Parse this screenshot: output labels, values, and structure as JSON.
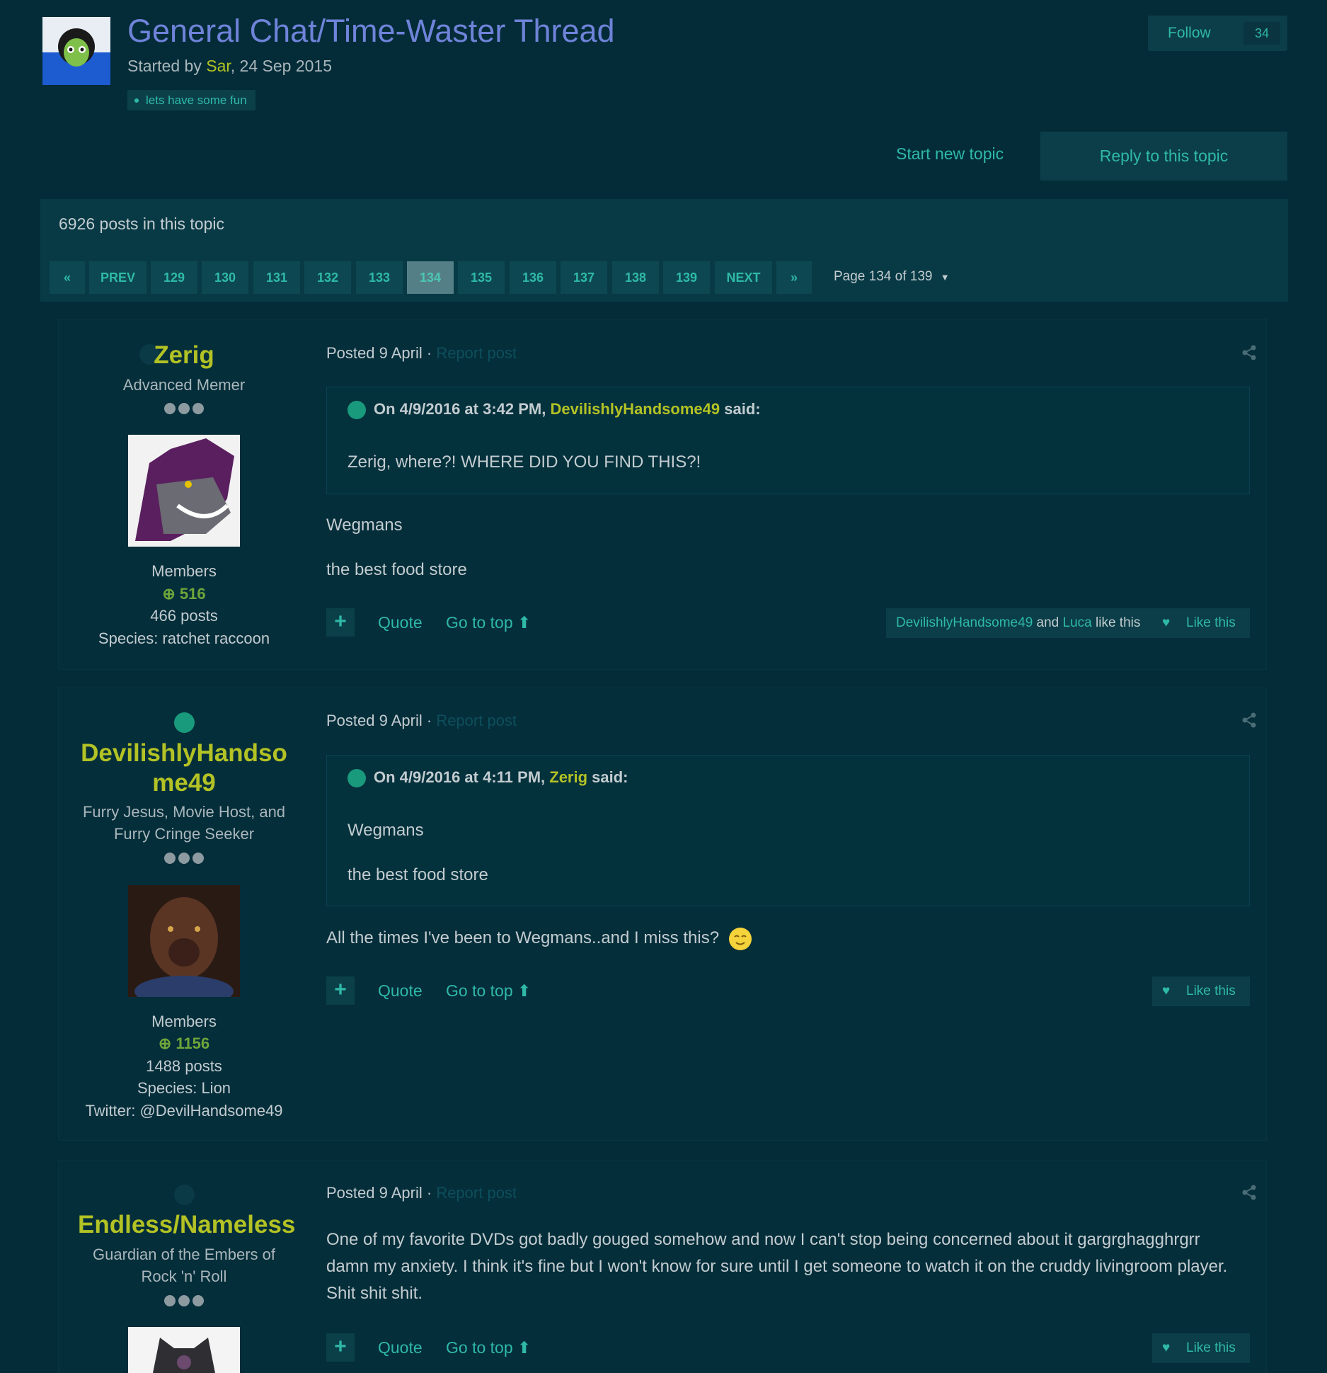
{
  "thread": {
    "title": "General Chat/Time-Waster Thread",
    "started_prefix": "Started by ",
    "author": "Sar",
    "date": ", 24 Sep 2015",
    "tag": "lets have some fun",
    "follow_label": "Follow",
    "follow_count": "34"
  },
  "actions": {
    "start_topic": "Start new topic",
    "reply": "Reply to this topic"
  },
  "pagination": {
    "post_count": "6926 posts in this topic",
    "prev": "PREV",
    "next": "NEXT",
    "pages": [
      "129",
      "130",
      "131",
      "132",
      "133",
      "134",
      "135",
      "136",
      "137",
      "138",
      "139"
    ],
    "current": "134",
    "page_of": "Page 134 of 139"
  },
  "posts": [
    {
      "username": "Zerig",
      "rank": "Advanced Memer",
      "group": "Members",
      "rep": "516",
      "post_count": "466 posts",
      "species": "Species: ratchet raccoon",
      "posted": "Posted 9 April",
      "report": "Report post",
      "quote_prefix": "On 4/9/2016 at 3:42 PM, ",
      "quote_author": "DevilishlyHandsome49",
      "quote_suffix": " said:",
      "quote_lines": [
        "Zerig, where?! WHERE DID YOU FIND THIS?!"
      ],
      "body": [
        "Wegmans",
        "the best food store"
      ],
      "likers_a": "DevilishlyHandsome49",
      "likers_and": " and ",
      "likers_b": "Luca",
      "likers_tail": " like this"
    },
    {
      "username_line1": "DevilishlyHandso",
      "username_line2": "me49",
      "rank_line1": "Furry Jesus, Movie Host, and",
      "rank_line2": "Furry Cringe Seeker",
      "group": "Members",
      "rep": "1156",
      "post_count": "1488 posts",
      "species": "Species: Lion",
      "twitter": "Twitter: @DevilHandsome49",
      "posted": "Posted 9 April",
      "report": "Report post",
      "quote_prefix": "On 4/9/2016 at 4:11 PM, ",
      "quote_author": "Zerig",
      "quote_suffix": " said:",
      "quote_lines": [
        "Wegmans",
        "the best food store"
      ],
      "body": [
        "All the times I've been to Wegmans..and I miss this?"
      ]
    },
    {
      "username": "Endless/Nameless",
      "rank_line1": "Guardian of the Embers of",
      "rank_line2": "Rock 'n' Roll",
      "posted": "Posted 9 April",
      "report": "Report post",
      "body_lines": [
        "One of my favorite DVDs got badly gouged somehow and now I can't stop being concerned about it gargrghagghrgrr",
        "damn my anxiety. I think it's fine but I won't know for sure until I get someone to watch it on the cruddy livingroom player.",
        "Shit shit shit."
      ]
    }
  ],
  "common": {
    "quote": "Quote",
    "go_to_top": "Go to top",
    "like": "Like this",
    "plus": "+",
    "separator": " · "
  },
  "icons": [
    "first-page-icon",
    "last-page-icon",
    "caret-down-icon",
    "share-icon",
    "quote-check-icon",
    "reply-arrow-icon",
    "plus-circle-icon",
    "heart-icon",
    "arrow-up-icon",
    "emoji-icon"
  ],
  "colors": {
    "background": "#032c38",
    "accent": "#2fb9a6",
    "username": "#b3c224",
    "title": "#6f83d9"
  }
}
